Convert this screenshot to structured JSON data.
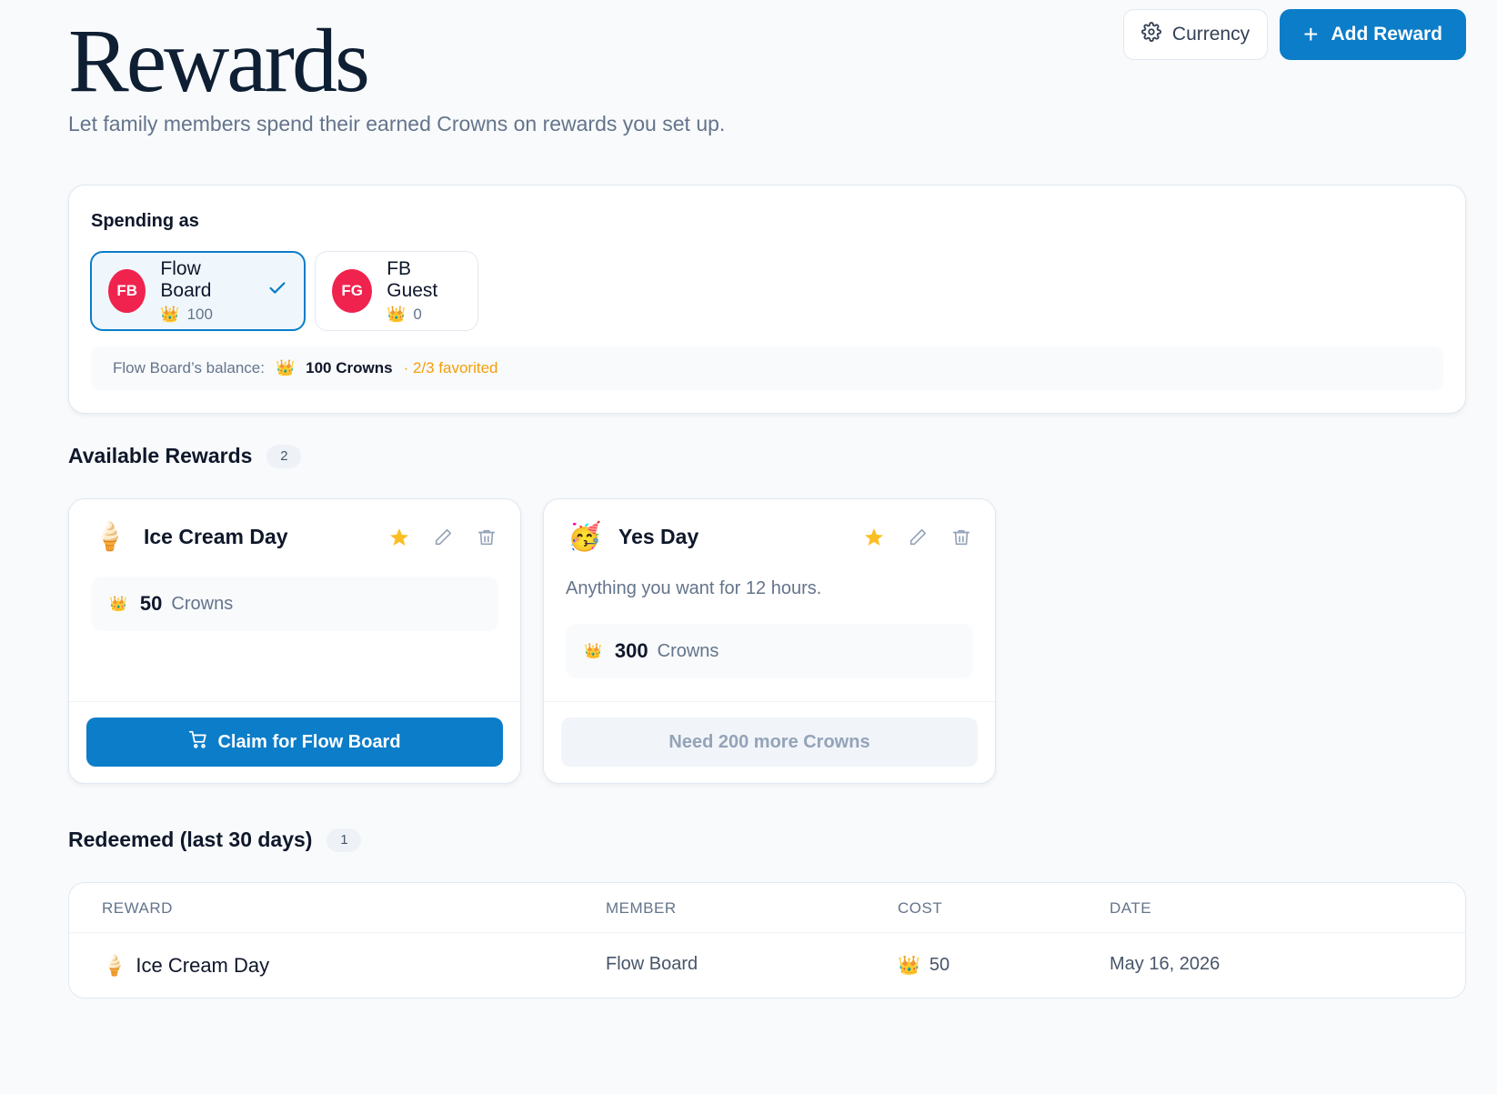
{
  "header": {
    "title": "Rewards",
    "subtitle": "Let family members spend their earned Crowns on rewards you set up.",
    "currency_label": "Currency",
    "add_reward_label": "Add Reward"
  },
  "spending": {
    "label": "Spending as",
    "members": [
      {
        "initials": "FB",
        "name": "Flow Board",
        "balance": "100",
        "selected": true
      },
      {
        "initials": "FG",
        "name": "FB Guest",
        "balance": "0",
        "selected": false
      }
    ],
    "balance_label": "Flow Board’s balance:",
    "balance_value": "100 Crowns",
    "favorited": "· 2/3 favorited"
  },
  "available": {
    "title": "Available Rewards",
    "count": "2",
    "rewards": [
      {
        "emoji": "🍦",
        "name": "Ice Cream Day",
        "description": "",
        "cost": "50",
        "unit": "Crowns",
        "favorite": true,
        "action_label": "Claim for Flow Board",
        "can_claim": true
      },
      {
        "emoji": "🥳",
        "name": "Yes Day",
        "description": "Anything you want for 12 hours.",
        "cost": "300",
        "unit": "Crowns",
        "favorite": true,
        "action_label": "Need 200 more Crowns",
        "can_claim": false
      }
    ]
  },
  "redeemed": {
    "title": "Redeemed (last 30 days)",
    "count": "1",
    "columns": [
      "REWARD",
      "MEMBER",
      "COST",
      "DATE"
    ],
    "rows": [
      {
        "emoji": "🍦",
        "reward": "Ice Cream Day",
        "member": "Flow Board",
        "cost": "50",
        "date": "May 16, 2026"
      }
    ]
  },
  "colors": {
    "accent": "#0b7dc9",
    "avatar": "#f0234e",
    "star": "#fbbf24",
    "favorited": "#f59e0b"
  },
  "icons": {
    "currency": "gear-icon",
    "add": "plus-icon",
    "crown": "crown-icon",
    "check": "check-icon",
    "star": "star-icon",
    "edit": "pencil-icon",
    "delete": "trash-icon",
    "cart": "cart-icon"
  }
}
